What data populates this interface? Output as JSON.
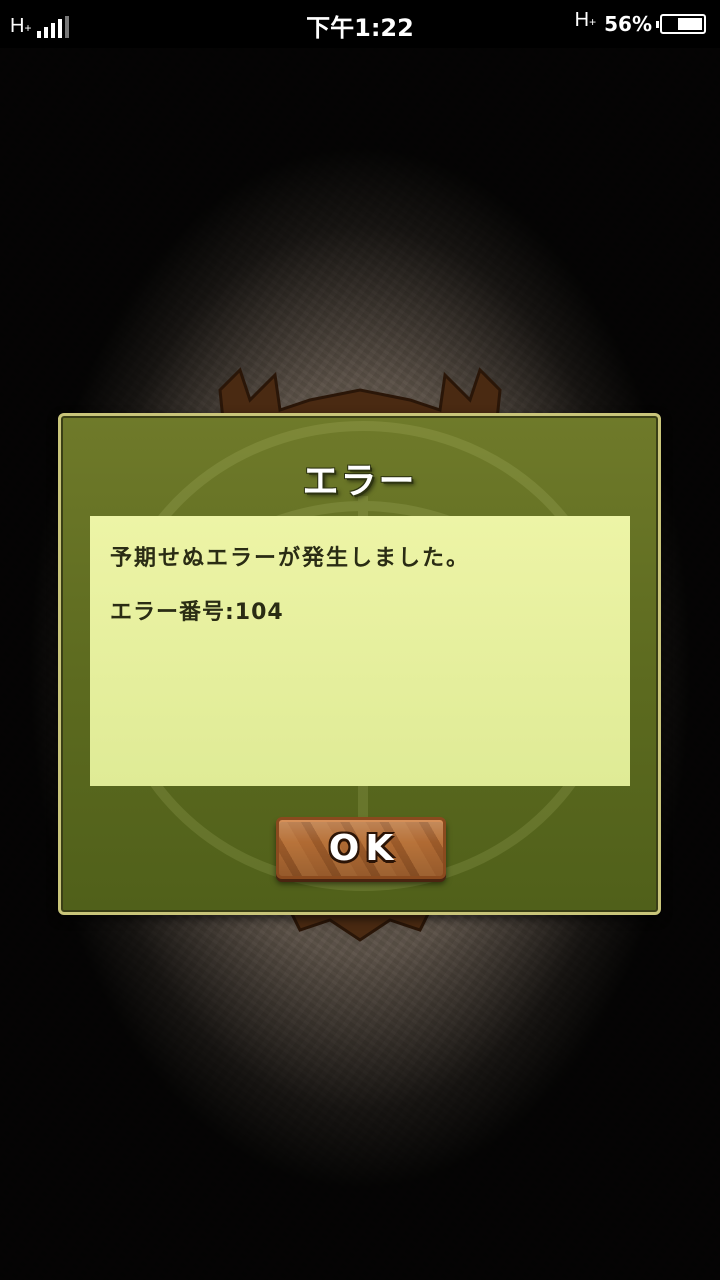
{
  "status_bar": {
    "network_left": "H",
    "network_left_sub": "+",
    "time": "下午1:22",
    "network_right": "H",
    "network_right_sub": "+",
    "battery_percent_label": "56%",
    "battery_level": 0.56
  },
  "dialog": {
    "title": "エラー",
    "message_line_1": "予期せぬエラーが発生しました。",
    "message_line_2": "エラー番号:104",
    "ok_label": "OK"
  },
  "colors": {
    "dialog_green": "#5c6a1f",
    "message_bg": "#e6ef9e",
    "ok_button_brown": "#a5622f",
    "background": "#5a5046"
  },
  "icons": {
    "signal": "signal-bars-icon",
    "battery": "battery-icon",
    "emblem": "dragon-emblem-icon"
  }
}
